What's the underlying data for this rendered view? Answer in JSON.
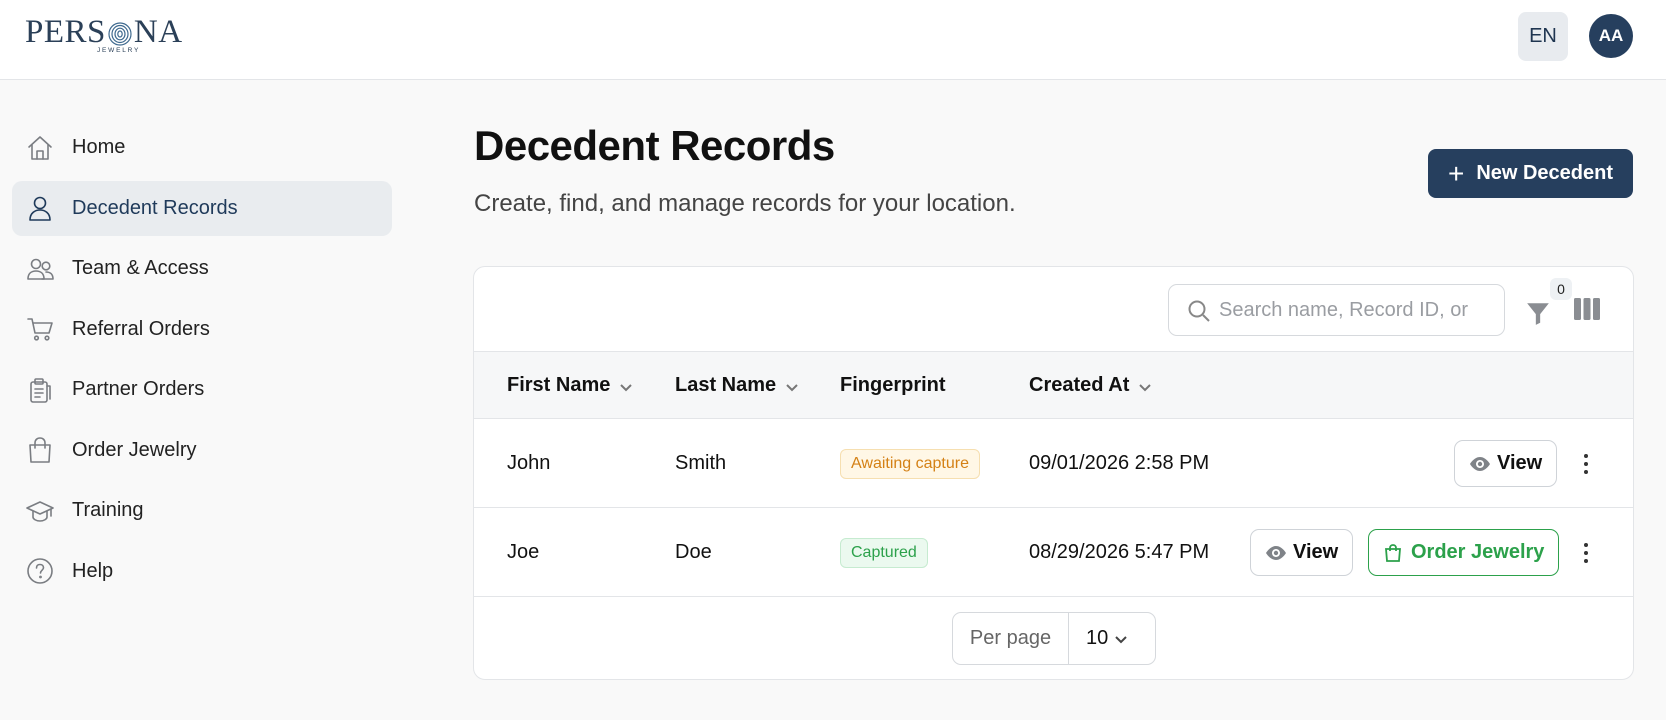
{
  "header": {
    "logo_text_left": "PERS",
    "logo_text_right": "NA",
    "logo_subtext": "JEWELRY",
    "language": "EN",
    "avatar_initials": "AA"
  },
  "sidebar": {
    "items": [
      {
        "label": "Home",
        "icon": "home-icon",
        "active": false
      },
      {
        "label": "Decedent Records",
        "icon": "user-icon",
        "active": true
      },
      {
        "label": "Team & Access",
        "icon": "users-icon",
        "active": false
      },
      {
        "label": "Referral Orders",
        "icon": "cart-icon",
        "active": false
      },
      {
        "label": "Partner Orders",
        "icon": "clipboard-icon",
        "active": false
      },
      {
        "label": "Order Jewelry",
        "icon": "shopping-bag-icon",
        "active": false
      },
      {
        "label": "Training",
        "icon": "graduation-cap-icon",
        "active": false
      },
      {
        "label": "Help",
        "icon": "help-circle-icon",
        "active": false
      }
    ]
  },
  "main": {
    "title": "Decedent Records",
    "subtitle": "Create, find, and manage records for your location.",
    "new_button_label": "New Decedent"
  },
  "toolbar": {
    "search_placeholder": "Search name, Record ID, or",
    "filter_count": "0"
  },
  "table": {
    "columns": [
      {
        "label": "First Name",
        "sortable": true
      },
      {
        "label": "Last Name",
        "sortable": true
      },
      {
        "label": "Fingerprint",
        "sortable": false
      },
      {
        "label": "Created At",
        "sortable": true
      }
    ],
    "rows": [
      {
        "first_name": "John",
        "last_name": "Smith",
        "fingerprint": "Awaiting capture",
        "created_at": "09/01/2026 2:58 PM",
        "view_label": "View"
      },
      {
        "first_name": "Joe",
        "last_name": "Doe",
        "fingerprint": "Captured",
        "created_at": "08/29/2026 5:47 PM",
        "view_label": "View",
        "order_label": "Order Jewelry"
      }
    ]
  },
  "pagination": {
    "per_page_label": "Per page",
    "per_page_value": "10"
  },
  "colors": {
    "primary": "#263f5e",
    "success": "#2ca14b",
    "warning": "#d48116"
  }
}
